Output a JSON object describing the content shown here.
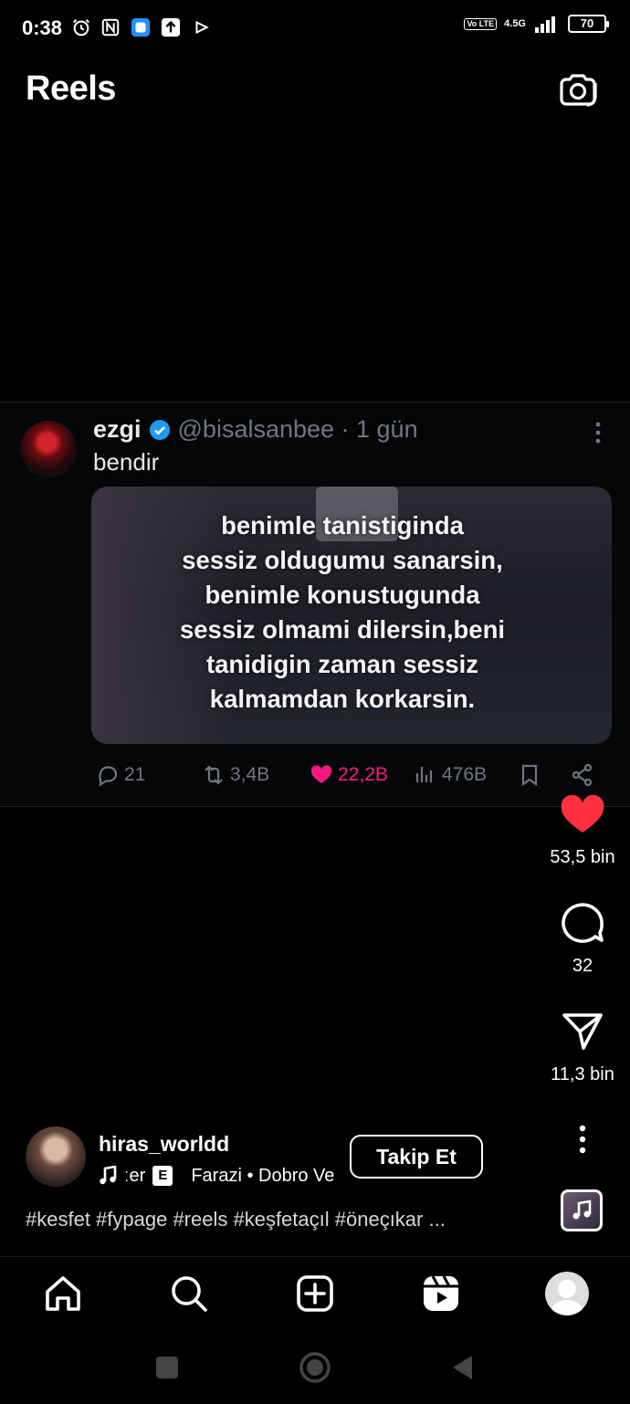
{
  "status_bar": {
    "time": "0:38",
    "volte": "Vo LTE",
    "network": "4.5G",
    "battery": "70"
  },
  "header": {
    "title": "Reels",
    "camera_icon": "camera-icon"
  },
  "tweet": {
    "name": "ezgi",
    "handle": "@bisalsanbee · 1 gün",
    "text": "bendir",
    "quote_lines": [
      "benimle tanistiginda",
      "sessiz oldugumu sanarsin,",
      "benimle konustugunda",
      "sessiz olmami dilersin,beni",
      "tanidigin zaman sessiz",
      "kalmamdan korkarsin."
    ],
    "replies": "21",
    "retweets": "3,4B",
    "likes": "22,2B",
    "views": "476B"
  },
  "actions": {
    "likes": "53,5 bin",
    "comments": "32",
    "shares": "11,3 bin",
    "like_color": "#ff3040"
  },
  "author": {
    "username": "hiras_worldd",
    "music_prefix": "ːer",
    "explicit": "E",
    "music_track": "Farazi • Dobro Ve",
    "follow_label": "Takip Et"
  },
  "caption": "#kesfet #fypage #reels #keşfetaçıl #öneçıkar ...",
  "bottom_nav": [
    "home-icon",
    "search-icon",
    "create-icon",
    "reels-icon",
    "profile-avatar"
  ],
  "system_nav": [
    "recents-button",
    "home-button",
    "back-button"
  ]
}
